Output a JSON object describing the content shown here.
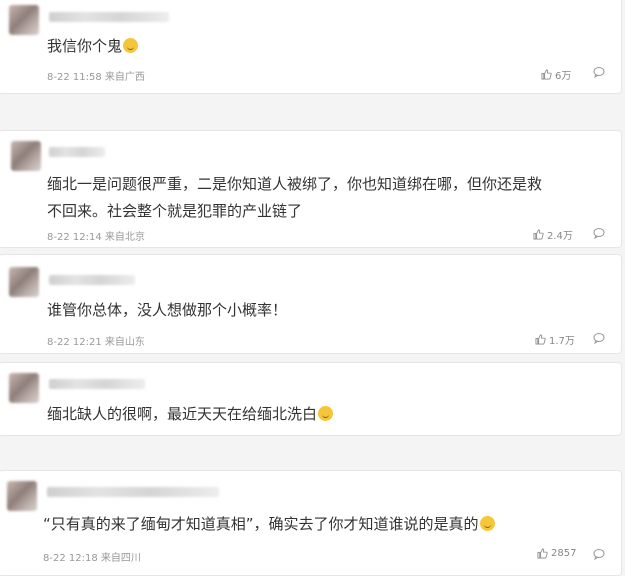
{
  "comments": [
    {
      "text": "我信你个鬼",
      "emoji": "smirk-emoji",
      "time": "8-22 11:58 来自广西",
      "likes": "6万"
    },
    {
      "text": "缅北一是问题很严重，二是你知道人被绑了，你也知道绑在哪，但你还是救",
      "text2": "不回来。社会整个就是犯罪的产业链了",
      "time": "8-22 12:14 来自北京",
      "likes": "2.4万"
    },
    {
      "text": "谁管你总体，没人想做那个小概率！",
      "time": "8-22 12:21 来自山东",
      "likes": "1.7万"
    },
    {
      "text": "缅北缺人的很啊，最近天天在给缅北洗白",
      "emoji": "laugh-emoji",
      "time": "",
      "likes": ""
    },
    {
      "text": "“只有真的来了缅甸才知道真相”，确实去了你才知道谁说的是真的",
      "emoji": "smirk-emoji",
      "time": "8-22 12:18 来自四川",
      "likes": "2857"
    }
  ]
}
